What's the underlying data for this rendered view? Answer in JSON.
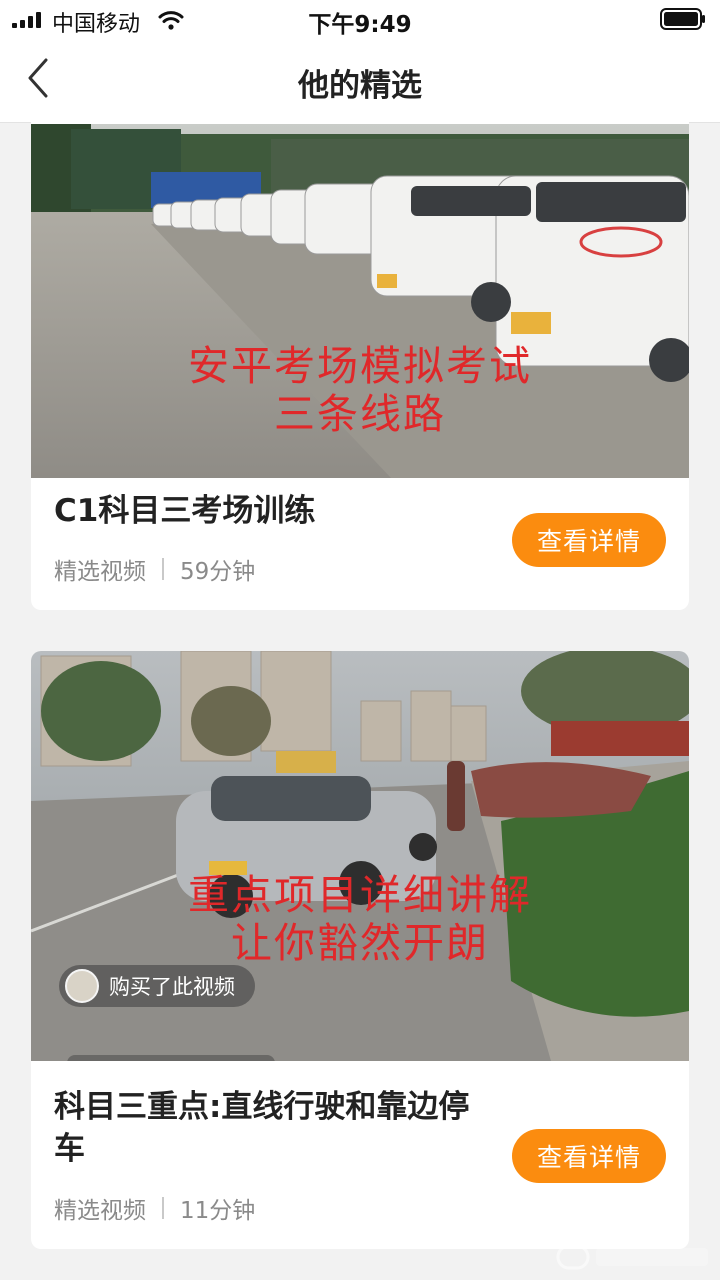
{
  "status_bar": {
    "carrier": "中国移动",
    "time": "下午9:49"
  },
  "nav": {
    "title": "他的精选",
    "back_icon": "chevron-left-icon"
  },
  "cards": [
    {
      "overlay_line1": "安平考场模拟考试",
      "overlay_line2": "三条线路",
      "title": "C1科目三考场训练",
      "category": "精选视频",
      "duration": "59分钟",
      "button_label": "查看详情"
    },
    {
      "overlay_line1": "重点项目详细讲解",
      "overlay_line2": "让你豁然开朗",
      "buyer_notice": "购买了此视频",
      "title": "科目三重点:直线行驶和靠边停车",
      "category": "精选视频",
      "duration": "11分钟",
      "button_label": "查看详情"
    }
  ],
  "colors": {
    "accent": "#fb8c0f",
    "overlay_text": "#e0282a",
    "background": "#f2f2f2"
  }
}
